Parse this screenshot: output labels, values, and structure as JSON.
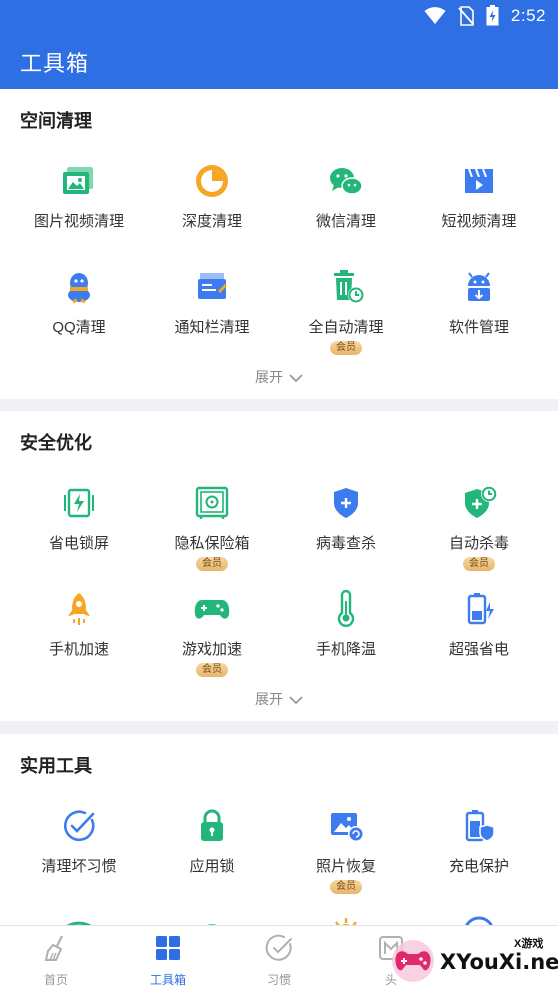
{
  "status_bar": {
    "time": "2:52",
    "icons": [
      "wifi-icon",
      "no-sim-icon",
      "battery-charging-icon"
    ]
  },
  "app_bar": {
    "title": "工具箱"
  },
  "sections": {
    "space_clean": {
      "title": "空间清理",
      "items": [
        {
          "label": "图片视频清理",
          "icon": "photo-video-icon"
        },
        {
          "label": "深度清理",
          "icon": "pie-chart-icon"
        },
        {
          "label": "微信清理",
          "icon": "wechat-icon"
        },
        {
          "label": "短视频清理",
          "icon": "short-video-icon"
        },
        {
          "label": "QQ清理",
          "icon": "qq-icon"
        },
        {
          "label": "通知栏清理",
          "icon": "notification-icon"
        },
        {
          "label": "全自动清理",
          "icon": "auto-clean-icon",
          "badge": "会员"
        },
        {
          "label": "软件管理",
          "icon": "android-icon"
        }
      ],
      "expand_label": "展开"
    },
    "security": {
      "title": "安全优化",
      "items": [
        {
          "label": "省电锁屏",
          "icon": "battery-lock-icon"
        },
        {
          "label": "隐私保险箱",
          "icon": "safe-icon",
          "badge": "会员"
        },
        {
          "label": "病毒查杀",
          "icon": "shield-plus-icon"
        },
        {
          "label": "自动杀毒",
          "icon": "auto-shield-icon",
          "badge": "会员"
        },
        {
          "label": "手机加速",
          "icon": "rocket-icon"
        },
        {
          "label": "游戏加速",
          "icon": "gamepad-icon",
          "badge": "会员"
        },
        {
          "label": "手机降温",
          "icon": "thermometer-icon"
        },
        {
          "label": "超强省电",
          "icon": "super-battery-icon"
        }
      ],
      "expand_label": "展开"
    },
    "utilities": {
      "title": "实用工具",
      "items": [
        {
          "label": "清理坏习惯",
          "icon": "habit-check-icon"
        },
        {
          "label": "应用锁",
          "icon": "padlock-icon"
        },
        {
          "label": "照片恢复",
          "icon": "photo-restore-icon",
          "badge": "会员"
        },
        {
          "label": "充电保护",
          "icon": "charge-protect-icon"
        }
      ]
    }
  },
  "tab_bar": {
    "tabs": [
      {
        "label": "首页",
        "icon": "broom-icon",
        "active": false
      },
      {
        "label": "工具箱",
        "icon": "grid-icon",
        "active": true
      },
      {
        "label": "习惯",
        "icon": "habit-icon",
        "active": false
      },
      {
        "label": "头",
        "icon": "profile-icon",
        "active": false
      }
    ]
  },
  "watermark": {
    "brand": "XYouXi.net",
    "tag": "X游戏"
  },
  "colors": {
    "primary": "#2f6fe4",
    "green": "#22b67a",
    "blue": "#3d7cf0",
    "orange": "#f5a623",
    "badge": "#e6b56b"
  }
}
